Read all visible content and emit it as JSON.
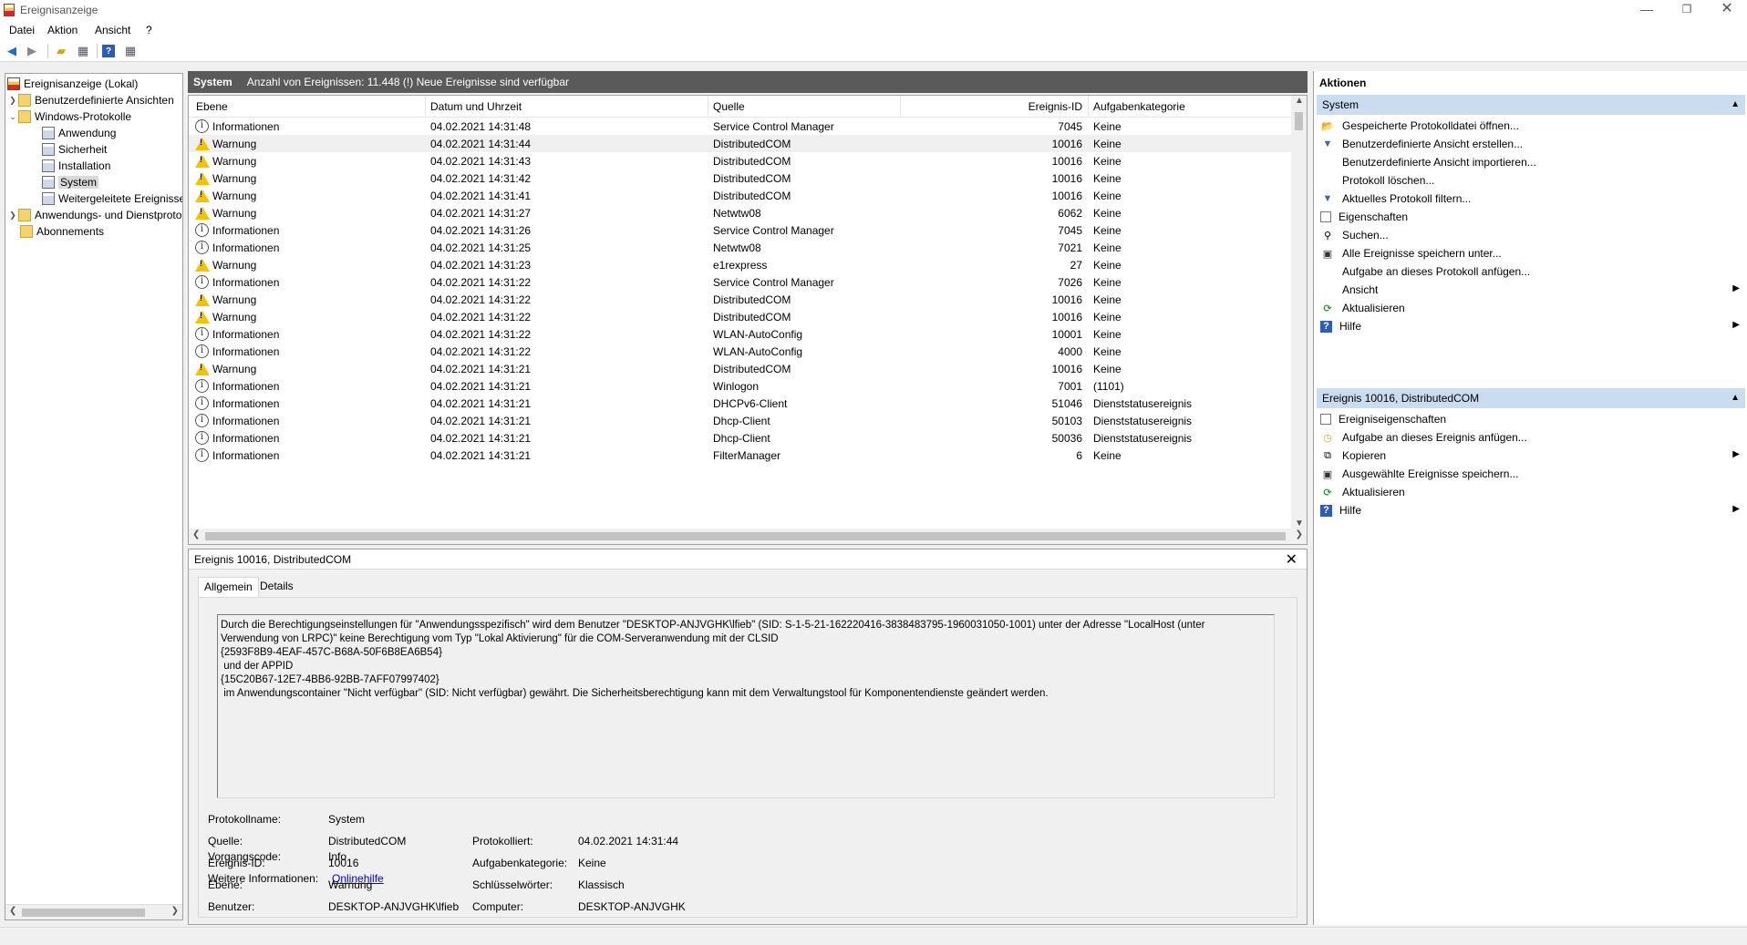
{
  "window": {
    "title": "Ereignisanzeige",
    "minimize": "—",
    "maximize": "❐",
    "close": "✕"
  },
  "menu": [
    "Datei",
    "Aktion",
    "Ansicht",
    "?"
  ],
  "tree": {
    "root": "Ereignisanzeige (Lokal)",
    "custom_views": "Benutzerdefinierte Ansichten",
    "windows_logs": "Windows-Protokolle",
    "logs": [
      "Anwendung",
      "Sicherheit",
      "Installation",
      "System",
      "Weitergeleitete Ereignisse"
    ],
    "app_services": "Anwendungs- und Dienstprotokolle",
    "subscriptions": "Abonnements"
  },
  "center": {
    "log_name": "System",
    "event_count": "Anzahl von Ereignissen: 11.448 (!) Neue Ereignisse sind verfügbar",
    "columns": [
      "Ebene",
      "Datum und Uhrzeit",
      "Quelle",
      "Ereignis-ID",
      "Aufgabenkategorie"
    ],
    "rows": [
      {
        "level": "Informationen",
        "type": "info",
        "date": "04.02.2021 14:31:48",
        "source": "Service Control Manager",
        "id": "7045",
        "category": "Keine"
      },
      {
        "level": "Warnung",
        "type": "warn",
        "date": "04.02.2021 14:31:44",
        "source": "DistributedCOM",
        "id": "10016",
        "category": "Keine"
      },
      {
        "level": "Warnung",
        "type": "warn",
        "date": "04.02.2021 14:31:43",
        "source": "DistributedCOM",
        "id": "10016",
        "category": "Keine"
      },
      {
        "level": "Warnung",
        "type": "warn",
        "date": "04.02.2021 14:31:42",
        "source": "DistributedCOM",
        "id": "10016",
        "category": "Keine"
      },
      {
        "level": "Warnung",
        "type": "warn",
        "date": "04.02.2021 14:31:41",
        "source": "DistributedCOM",
        "id": "10016",
        "category": "Keine"
      },
      {
        "level": "Warnung",
        "type": "warn",
        "date": "04.02.2021 14:31:27",
        "source": "Netwtw08",
        "id": "6062",
        "category": "Keine"
      },
      {
        "level": "Informationen",
        "type": "info",
        "date": "04.02.2021 14:31:26",
        "source": "Service Control Manager",
        "id": "7045",
        "category": "Keine"
      },
      {
        "level": "Informationen",
        "type": "info",
        "date": "04.02.2021 14:31:25",
        "source": "Netwtw08",
        "id": "7021",
        "category": "Keine"
      },
      {
        "level": "Warnung",
        "type": "warn",
        "date": "04.02.2021 14:31:23",
        "source": "e1rexpress",
        "id": "27",
        "category": "Keine"
      },
      {
        "level": "Informationen",
        "type": "info",
        "date": "04.02.2021 14:31:22",
        "source": "Service Control Manager",
        "id": "7026",
        "category": "Keine"
      },
      {
        "level": "Warnung",
        "type": "warn",
        "date": "04.02.2021 14:31:22",
        "source": "DistributedCOM",
        "id": "10016",
        "category": "Keine"
      },
      {
        "level": "Warnung",
        "type": "warn",
        "date": "04.02.2021 14:31:22",
        "source": "DistributedCOM",
        "id": "10016",
        "category": "Keine"
      },
      {
        "level": "Informationen",
        "type": "info",
        "date": "04.02.2021 14:31:22",
        "source": "WLAN-AutoConfig",
        "id": "10001",
        "category": "Keine"
      },
      {
        "level": "Informationen",
        "type": "info",
        "date": "04.02.2021 14:31:22",
        "source": "WLAN-AutoConfig",
        "id": "4000",
        "category": "Keine"
      },
      {
        "level": "Warnung",
        "type": "warn",
        "date": "04.02.2021 14:31:21",
        "source": "DistributedCOM",
        "id": "10016",
        "category": "Keine"
      },
      {
        "level": "Informationen",
        "type": "info",
        "date": "04.02.2021 14:31:21",
        "source": "Winlogon",
        "id": "7001",
        "category": "(1101)"
      },
      {
        "level": "Informationen",
        "type": "info",
        "date": "04.02.2021 14:31:21",
        "source": "DHCPv6-Client",
        "id": "51046",
        "category": "Dienststatusereignis"
      },
      {
        "level": "Informationen",
        "type": "info",
        "date": "04.02.2021 14:31:21",
        "source": "Dhcp-Client",
        "id": "50103",
        "category": "Dienststatusereignis"
      },
      {
        "level": "Informationen",
        "type": "info",
        "date": "04.02.2021 14:31:21",
        "source": "Dhcp-Client",
        "id": "50036",
        "category": "Dienststatusereignis"
      },
      {
        "level": "Informationen",
        "type": "info",
        "date": "04.02.2021 14:31:21",
        "source": "FilterManager",
        "id": "6",
        "category": "Keine"
      }
    ],
    "selected_row": 1
  },
  "detail": {
    "title": "Ereignis 10016, DistributedCOM",
    "tabs": [
      "Allgemein",
      "Details"
    ],
    "description": "Durch die Berechtigungseinstellungen für \"Anwendungsspezifisch\" wird dem Benutzer \"DESKTOP-ANJVGHK\\lfieb\" (SID: S-1-5-21-162220416-3838483795-1960031050-1001) unter der Adresse \"LocalHost (unter\nVerwendung von LRPC)\" keine Berechtigung vom Typ \"Lokal Aktivierung\" für die COM-Serveranwendung mit der CLSID\n{2593F8B9-4EAF-457C-B68A-50F6B8EA6B54}\n und der APPID\n{15C20B67-12E7-4BB6-92BB-7AFF07997402}\n im Anwendungscontainer \"Nicht verfügbar\" (SID: Nicht verfügbar) gewährt. Die Sicherheitsberechtigung kann mit dem Verwaltungstool für Komponentendienste geändert werden.",
    "labels": {
      "log_name": "Protokollname:",
      "source": "Quelle:",
      "event_id": "Ereignis-ID:",
      "level": "Ebene:",
      "user": "Benutzer:",
      "opcode": "Vorgangscode:",
      "more_info": "Weitere Informationen:",
      "logged": "Protokolliert:",
      "task_category": "Aufgabenkategorie:",
      "keywords": "Schlüsselwörter:",
      "computer": "Computer:"
    },
    "values": {
      "log_name": "System",
      "source": "DistributedCOM",
      "event_id": "10016",
      "level": "Warnung",
      "user": "DESKTOP-ANJVGHK\\lfieb",
      "opcode": "Info",
      "more_info": "Onlinehilfe",
      "logged": "04.02.2021 14:31:44",
      "task_category": "Keine",
      "keywords": "Klassisch",
      "computer": "DESKTOP-ANJVGHK"
    }
  },
  "actions": {
    "title": "Aktionen",
    "section1": "System",
    "section1_items": [
      {
        "label": "Gespeicherte Protokolldatei öffnen...",
        "icon": "open-icon"
      },
      {
        "label": "Benutzerdefinierte Ansicht erstellen...",
        "icon": "filter-icon"
      },
      {
        "label": "Benutzerdefinierte Ansicht importieren...",
        "icon": ""
      },
      {
        "label": "Protokoll löschen...",
        "icon": ""
      },
      {
        "label": "Aktuelles Protokoll filtern...",
        "icon": "filter-icon"
      },
      {
        "label": "Eigenschaften",
        "icon": "properties-icon"
      },
      {
        "label": "Suchen...",
        "icon": "find-icon"
      },
      {
        "label": "Alle Ereignisse speichern unter...",
        "icon": "save-icon"
      },
      {
        "label": "Aufgabe an dieses Protokoll anfügen...",
        "icon": ""
      },
      {
        "label": "Ansicht",
        "icon": "",
        "submenu": true
      },
      {
        "label": "Aktualisieren",
        "icon": "refresh-icon"
      },
      {
        "label": "Hilfe",
        "icon": "help-icon",
        "submenu": true
      }
    ],
    "section2": "Ereignis 10016, DistributedCOM",
    "section2_items": [
      {
        "label": "Ereigniseigenschaften",
        "icon": "properties-icon"
      },
      {
        "label": "Aufgabe an dieses Ereignis anfügen...",
        "icon": "task-icon"
      },
      {
        "label": "Kopieren",
        "icon": "copy-icon",
        "submenu": true
      },
      {
        "label": "Ausgewählte Ereignisse speichern...",
        "icon": "save-icon"
      },
      {
        "label": "Aktualisieren",
        "icon": "refresh-icon"
      },
      {
        "label": "Hilfe",
        "icon": "help-icon",
        "submenu": true
      }
    ]
  },
  "colors": {
    "header_bg": "#5a5a5a",
    "section_bg": "#c9dcf0",
    "warning": "#f4c300",
    "link": "#0000ee"
  }
}
